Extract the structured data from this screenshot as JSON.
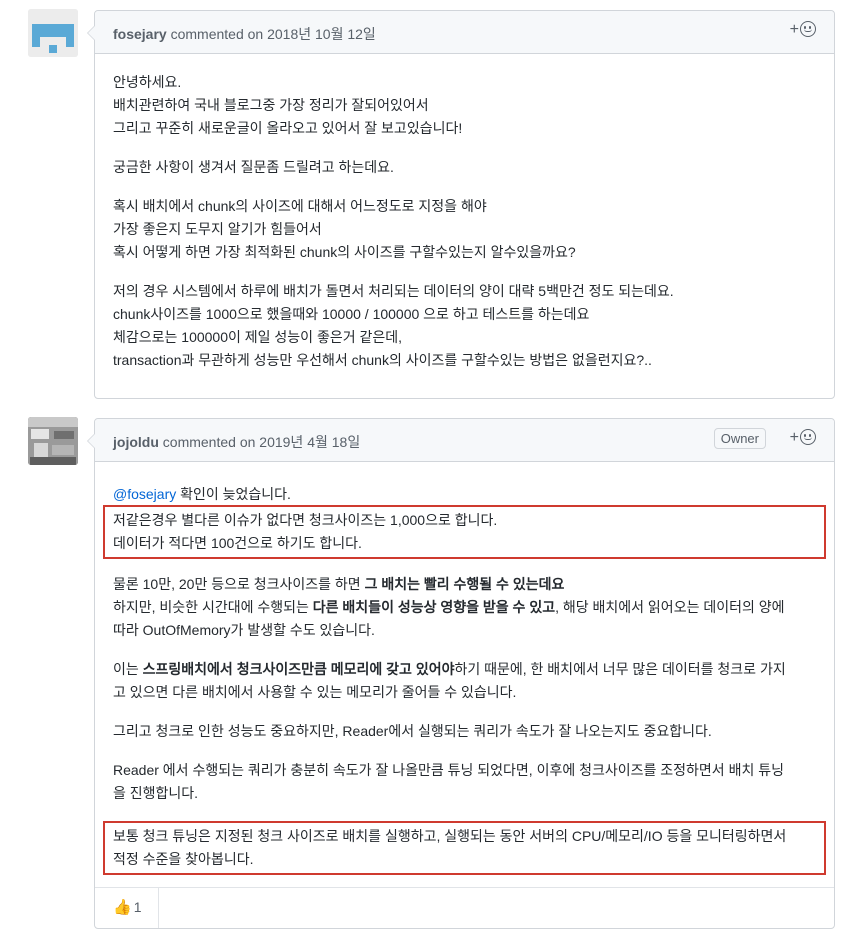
{
  "comments": [
    {
      "author": "fosejary",
      "action": "commented on",
      "date": "2018년 10월 12일",
      "paragraphs": [
        [
          "안녕하세요.",
          "배치관련하여 국내 블로그중 가장 정리가 잘되어있어서",
          "그리고 꾸준히 새로운글이 올라오고 있어서 잘 보고있습니다!"
        ],
        [
          "궁금한 사항이 생겨서 질문좀 드릴려고 하는데요."
        ],
        [
          "혹시 배치에서 chunk의 사이즈에 대해서 어느정도로 지정을 해야",
          "가장 좋은지 도무지 알기가 힘들어서",
          "혹시 어떻게 하면 가장 최적화된 chunk의 사이즈를 구할수있는지 알수있을까요?"
        ],
        [
          "저의 경우 시스템에서 하루에 배치가 돌면서 처리되는 데이터의 양이 대략 5백만건 정도 되는데요.",
          "chunk사이즈를 1000으로 했을때와 10000 / 100000 으로 하고 테스트를 하는데요",
          "체감으로는 100000이 제일 성능이 좋은거 같은데,",
          "transaction과 무관하게 성능만 우선해서 chunk의 사이즈를 구할수있는 방법은 없을런지요?.."
        ]
      ]
    },
    {
      "author": "jojoldu",
      "action": "commented on",
      "date": "2019년 4월 18일",
      "badge": "Owner",
      "mention": "@fosejary",
      "intro": " 확인이 늦었습니다.",
      "highlight1": [
        "저같은경우 별다른 이슈가 없다면 청크사이즈는 1,000으로 합니다.",
        "데이터가 적다면 100건으로 하기도 합니다."
      ],
      "p2": {
        "a": "물론 10만, 20만 등으로 청크사이즈를 하면 ",
        "b": "그 배치는 빨리 수행될 수 있는데요",
        "c": "하지만, 비슷한 시간대에 수행되는 ",
        "d": "다른 배치들이 성능상 영향을 받을 수 있고",
        "e": ", 해당 배치에서 읽어오는 데이터의 양에",
        "f": "따라 OutOfMemory가 발생할 수도 있습니다."
      },
      "p3": {
        "a": "이는 ",
        "b": "스프링배치에서 청크사이즈만큼 메모리에 갖고 있어야",
        "c": "하기 때문에, 한 배치에서 너무 많은 데이터를 청크로 가지",
        "d": "고 있으면 다른 배치에서 사용할 수 있는 메모리가 줄어들 수 있습니다."
      },
      "p4": "그리고 청크로 인한 성능도 중요하지만, Reader에서 실행되는 쿼리가 속도가 잘 나오는지도 중요합니다.",
      "p5": [
        "Reader 에서 수행되는 쿼리가 충분히 속도가 잘 나올만큼 튜닝 되었다면, 이후에 청크사이즈를 조정하면서 배치 튜닝",
        "을 진행합니다."
      ],
      "highlight2": [
        "보통 청크 튜닝은 지정된 청크 사이즈로 배치를 실행하고, 실행되는 동안 서버의 CPU/메모리/IO 등을 모니터링하면서",
        "적정 수준을 찾아봅니다."
      ],
      "reaction": {
        "icon": "thumbs-up-icon",
        "emoji": "👍",
        "count": "1"
      }
    }
  ],
  "add_reaction_plus": "+",
  "colors": {
    "highlight": "#cf3a2f",
    "link": "#0366d6",
    "header_bg": "#f6f8fa"
  }
}
